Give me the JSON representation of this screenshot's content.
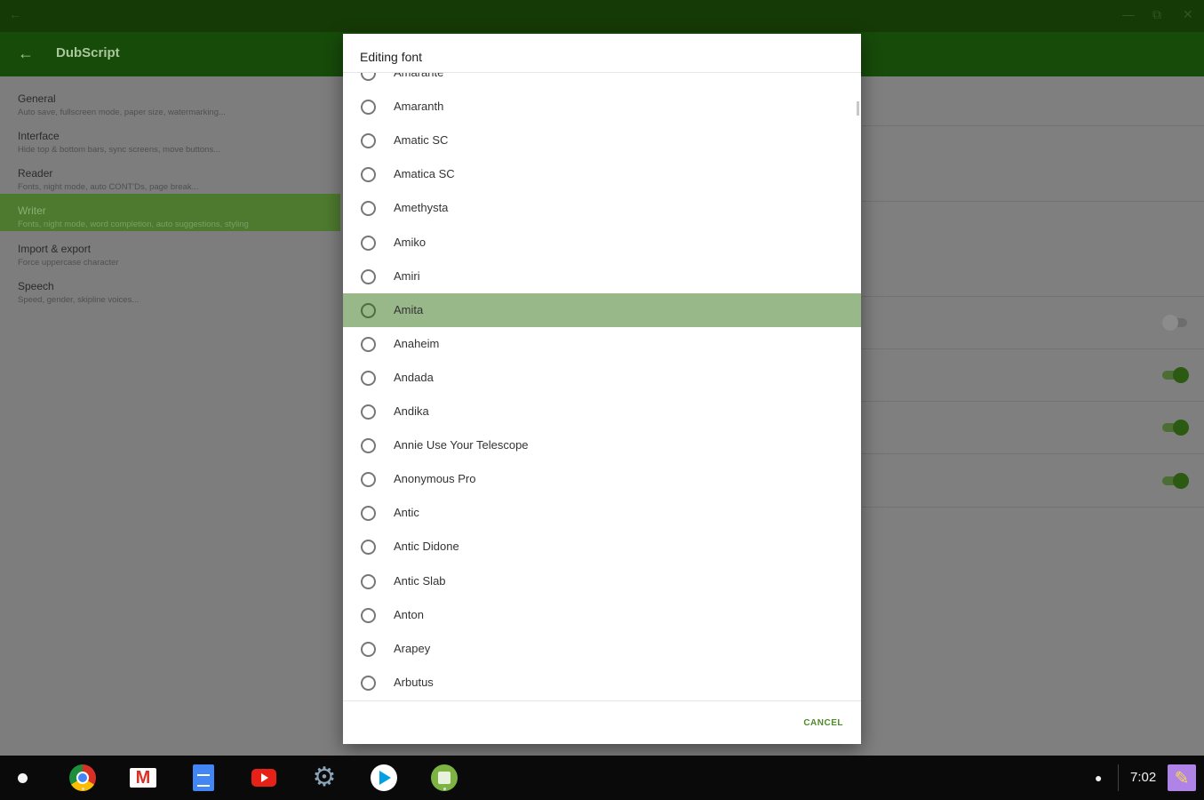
{
  "window": {
    "controls": [
      "←",
      "—",
      "⧉",
      "✕"
    ]
  },
  "appbar": {
    "back_glyph": "←",
    "title": "DubScript"
  },
  "sidebar": {
    "items": [
      {
        "label": "General",
        "desc": "Auto save, fullscreen mode, paper size, watermarking..."
      },
      {
        "label": "Interface",
        "desc": "Hide top & bottom bars, sync screens, move buttons..."
      },
      {
        "label": "Reader",
        "desc": "Fonts, night mode, auto CONT'Ds, page break..."
      },
      {
        "label": "Writer",
        "desc": "Fonts, night mode, word completion, auto suggestions, styling"
      },
      {
        "label": "Import & export",
        "desc": "Force uppercase character"
      },
      {
        "label": "Speech",
        "desc": "Speed, gender, skipline voices..."
      }
    ],
    "active_index": 3
  },
  "right_pane": {
    "toggles": [
      false,
      true,
      true,
      true
    ]
  },
  "dialog": {
    "title": "Editing font",
    "fonts": [
      "Amarante",
      "Amaranth",
      "Amatic SC",
      "Amatica SC",
      "Amethysta",
      "Amiko",
      "Amiri",
      "Amita",
      "Anaheim",
      "Andada",
      "Andika",
      "Annie Use Your Telescope",
      "Anonymous Pro",
      "Antic",
      "Antic Didone",
      "Antic Slab",
      "Anton",
      "Arapey",
      "Arbutus"
    ],
    "highlighted": "Amita",
    "cancel_label": "CANCEL"
  },
  "shelf": {
    "apps": [
      {
        "name": "chrome",
        "icon": "chrome-icon"
      },
      {
        "name": "gmail",
        "icon": "gmail-icon"
      },
      {
        "name": "docs",
        "icon": "docs-icon"
      },
      {
        "name": "youtube",
        "icon": "youtube-icon"
      },
      {
        "name": "settings",
        "icon": "settings-icon"
      },
      {
        "name": "play-store",
        "icon": "play-store-icon"
      },
      {
        "name": "dubscript",
        "icon": "dubscript-icon"
      }
    ],
    "time": "7:02"
  },
  "colors": {
    "titlebar": "#163a06",
    "appbar": "#174b0a",
    "accent": "#4f8a2b",
    "selected_row": "#98b88a"
  }
}
